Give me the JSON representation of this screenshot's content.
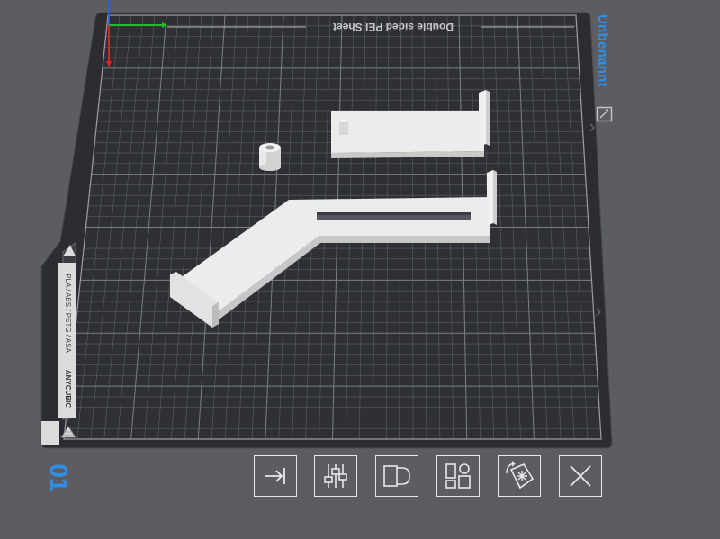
{
  "plate": {
    "name": "Unbenannt",
    "number": "01",
    "sheet_label": "Double sided PEI Sheet",
    "side_label_brand": "ANYCUBIC",
    "side_label_materials": "PLA / ABS / PETG / ASA"
  },
  "icons": {
    "plate_edit": "edit-icon",
    "toolbar": [
      "move-to-edge-icon",
      "slider-settings-icon",
      "arrange-icon",
      "layout-grid-icon",
      "auto-orient-icon",
      "close-icon"
    ]
  },
  "colors": {
    "accent": "#2f8fe8",
    "background": "#5b5d63",
    "plate": "#2d2f34",
    "grid": "#6e7178",
    "model": "#e6e6e6"
  }
}
